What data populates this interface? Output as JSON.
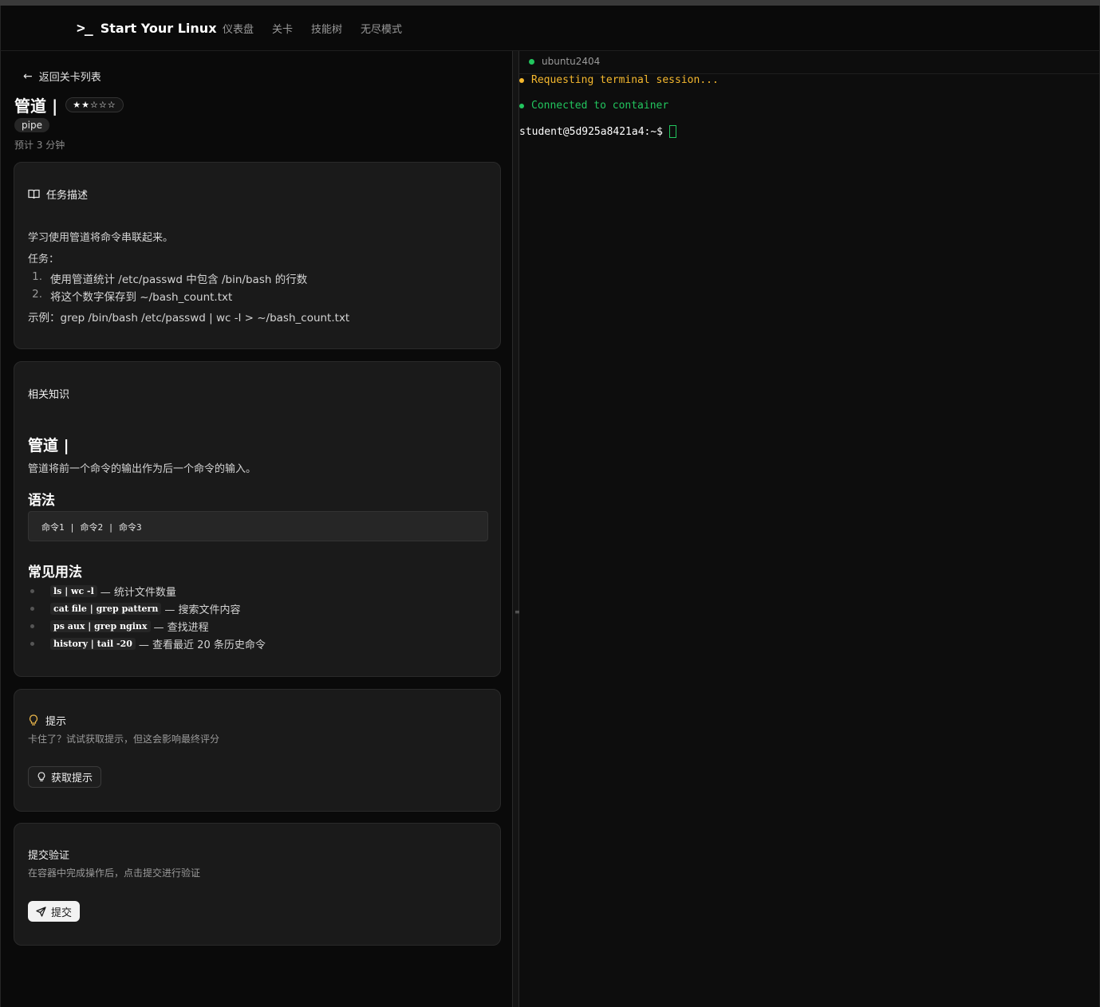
{
  "nav": {
    "brand_icon": ">_",
    "brand": "Start Your Linux",
    "links": [
      "仪表盘",
      "关卡",
      "技能树",
      "无尽模式"
    ]
  },
  "level": {
    "back": "返回关卡列表",
    "title": "管道 |",
    "stars": "★★☆☆☆",
    "tag": "pipe",
    "estimate": "预计 3 分钟"
  },
  "task": {
    "heading": "任务描述",
    "intro": "学习使用管道将命令串联起来。",
    "tasks_label": "任务：",
    "items": [
      {
        "num": "1.",
        "text": "使用管道统计 /etc/passwd 中包含 /bin/bash 的行数"
      },
      {
        "num": "2.",
        "text": "将这个数字保存到 ~/bash_count.txt"
      }
    ],
    "example": "示例：grep /bin/bash /etc/passwd | wc -l > ~/bash_count.txt"
  },
  "knowledge": {
    "heading": "相关知识",
    "title": "管道 |",
    "desc": "管道将前一个命令的输出作为后一个命令的输入。",
    "syntax_heading": "语法",
    "syntax": "命令1 | 命令2 | 命令3",
    "usage_heading": "常见用法",
    "usages": [
      {
        "code": "ls | wc -l",
        "text": "— 统计文件数量"
      },
      {
        "code": "cat file | grep pattern",
        "text": "— 搜索文件内容"
      },
      {
        "code": "ps aux | grep nginx",
        "text": "— 查找进程"
      },
      {
        "code": "history | tail -20",
        "text": "— 查看最近 20 条历史命令"
      }
    ]
  },
  "hint": {
    "heading": "提示",
    "sub": "卡住了？试试获取提示，但这会影响最终评分",
    "button": "获取提示"
  },
  "submit": {
    "heading": "提交验证",
    "sub": "在容器中完成操作后，点击提交进行验证",
    "button": "提交"
  },
  "terminal": {
    "tab": "ubuntu2404",
    "line1": "Requesting terminal session...",
    "line2": "Connected to container",
    "prompt": "student@5d925a8421a4:~$",
    "colors": {
      "pending": "#f5b82e",
      "connected": "#22c55e"
    }
  }
}
